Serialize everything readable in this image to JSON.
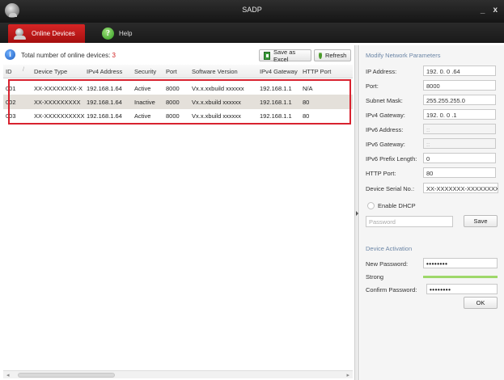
{
  "app": {
    "title": "SADP",
    "minimize": "_",
    "close": "x"
  },
  "tabs": [
    {
      "label": "Online Devices",
      "icon": "devices-icon",
      "active": true
    },
    {
      "label": "Help",
      "icon": "help-icon",
      "active": false
    }
  ],
  "toolbar": {
    "total_label": "Total number of online devices:",
    "total_count": "3",
    "save_excel": "Save as Excel",
    "refresh": "Refresh"
  },
  "table": {
    "columns": [
      "ID",
      "Device Type",
      "IPv4 Address",
      "Security",
      "Port",
      "Software Version",
      "IPv4 Gateway",
      "HTTP Port"
    ],
    "rows": [
      [
        "001",
        "XX-XXXXXXXX-X",
        "192.168.1.64",
        "Active",
        "8000",
        "Vx.x.xxbuild xxxxxx",
        "192.168.1.1",
        "N/A"
      ],
      [
        "002",
        "XX-XXXXXXXXX",
        "192.168.1.64",
        "Inactive",
        "8000",
        "Vx.x.xbuild xxxxxx",
        "192.168.1.1",
        "80"
      ],
      [
        "003",
        "XX-XXXXXXXXXX",
        "192.168.1.64",
        "Active",
        "8000",
        "Vx.x.xbuild xxxxxx",
        "192.168.1.1",
        "80"
      ]
    ]
  },
  "modify": {
    "title": "Modify Network Parameters",
    "ip_label": "IP Address:",
    "ip_value": "192. 0. 0 .64",
    "port_label": "Port:",
    "port_value": "8000",
    "mask_label": "Subnet Mask:",
    "mask_value": "255.255.255.0",
    "gw4_label": "IPv4 Gateway:",
    "gw4_value": "192. 0. 0 .1",
    "ip6_label": "IPv6 Address:",
    "ip6_value": "::",
    "gw6_label": "IPv6 Gateway:",
    "gw6_value": "::",
    "prefix_label": "IPv6 Prefix Length:",
    "prefix_value": "0",
    "http_label": "HTTP Port:",
    "http_value": "80",
    "serial_label": "Device Serial No.:",
    "serial_value": "XX-XXXXXXX-XXXXXXXX",
    "dhcp_label": "Enable DHCP",
    "password_placeholder": "Password",
    "save": "Save"
  },
  "activation": {
    "title": "Device Activation",
    "new_pwd_label": "New Password:",
    "new_pwd_value": "••••••••",
    "strength_label": "Strong",
    "strength_level": 1.0,
    "confirm_label": "Confirm Password:",
    "confirm_value": "••••••••",
    "ok": "OK"
  }
}
